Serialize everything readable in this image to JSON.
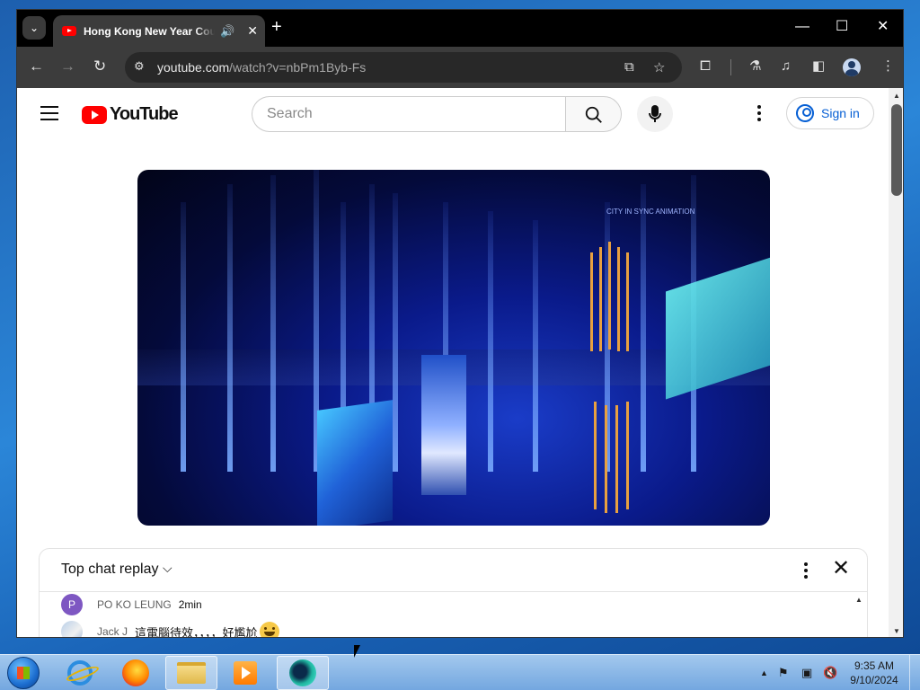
{
  "browser": {
    "tab_title": "Hong Kong New Year Countdown",
    "url_domain": "youtube.com",
    "url_path": "/watch?v=nbPm1Byb-Fs",
    "window_controls": {
      "minimize": "—",
      "maximize": "☐",
      "close": "✕"
    }
  },
  "youtube": {
    "logo_text": "YouTube",
    "search_placeholder": "Search",
    "signin_label": "Sign in",
    "video_overlay_text": "CITY IN SYNC ANIMATION"
  },
  "chat": {
    "title": "Top chat replay",
    "messages": [
      {
        "avatar_letter": "P",
        "author": "PO KO LEUNG",
        "time": "2min",
        "text": ""
      },
      {
        "avatar_letter": "",
        "author": "Jack J",
        "time": "",
        "text": "這電腦待效，，，，好尷尬"
      }
    ]
  },
  "taskbar": {
    "apps": [
      "internet-explorer",
      "firefox",
      "file-explorer",
      "media-player",
      "edge"
    ],
    "clock_time": "9:35 AM",
    "clock_date": "9/10/2024"
  },
  "colors": {
    "youtube_red": "#ff0000",
    "signin_blue": "#065fd4",
    "chrome_dark": "#3c3c3c"
  }
}
